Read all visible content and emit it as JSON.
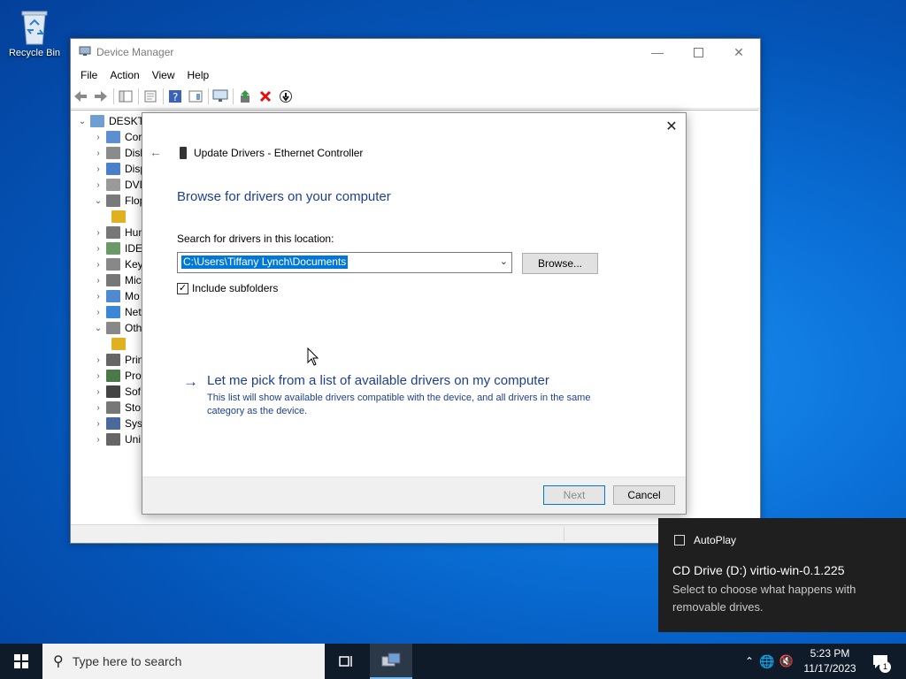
{
  "desktop": {
    "recycle_bin_label": "Recycle Bin"
  },
  "device_manager": {
    "title": "Device Manager",
    "menu": [
      "File",
      "Action",
      "View",
      "Help"
    ],
    "tree": {
      "root": "DESKTO",
      "items": [
        "Cor",
        "Disk",
        "Disp",
        "DVD",
        "Flop",
        "",
        "Hum",
        "IDE",
        "Key",
        "Mic",
        "Mo",
        "Net",
        "Oth",
        "",
        "Prin",
        "Pro",
        "Sof",
        "Sto",
        "Syst",
        "Uni"
      ]
    }
  },
  "dialog": {
    "title": "Update Drivers - Ethernet Controller",
    "heading": "Browse for drivers on your computer",
    "search_label": "Search for drivers in this location:",
    "path_value": "C:\\Users\\Tiffany Lynch\\Documents",
    "browse_label": "Browse...",
    "include_subfolders_label": "Include subfolders",
    "include_subfolders_checked": true,
    "pick_link": "Let me pick from a list of available drivers on my computer",
    "pick_description": "This list will show available drivers compatible with the device, and all drivers in the same category as the device.",
    "next_label": "Next",
    "cancel_label": "Cancel"
  },
  "notification": {
    "app": "AutoPlay",
    "title": "CD Drive (D:) virtio-win-0.1.225",
    "body": "Select to choose what happens with removable drives."
  },
  "taskbar": {
    "search_placeholder": "Type here to search",
    "time": "5:23 PM",
    "date": "11/17/2023",
    "notification_count": "1"
  },
  "colors": {
    "accent": "#0078d7",
    "link": "#1c3f94",
    "taskbar": "#101b29",
    "toast": "#1f1f1f"
  }
}
